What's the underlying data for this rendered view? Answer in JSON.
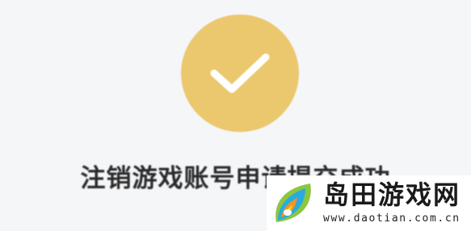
{
  "status": {
    "icon": "checkmark-icon",
    "accent_color": "#ebc86e",
    "message": "注销游戏账号申请提交成功"
  },
  "watermark": {
    "name": "岛田游戏网",
    "url": "www.daotian.com.cn"
  }
}
